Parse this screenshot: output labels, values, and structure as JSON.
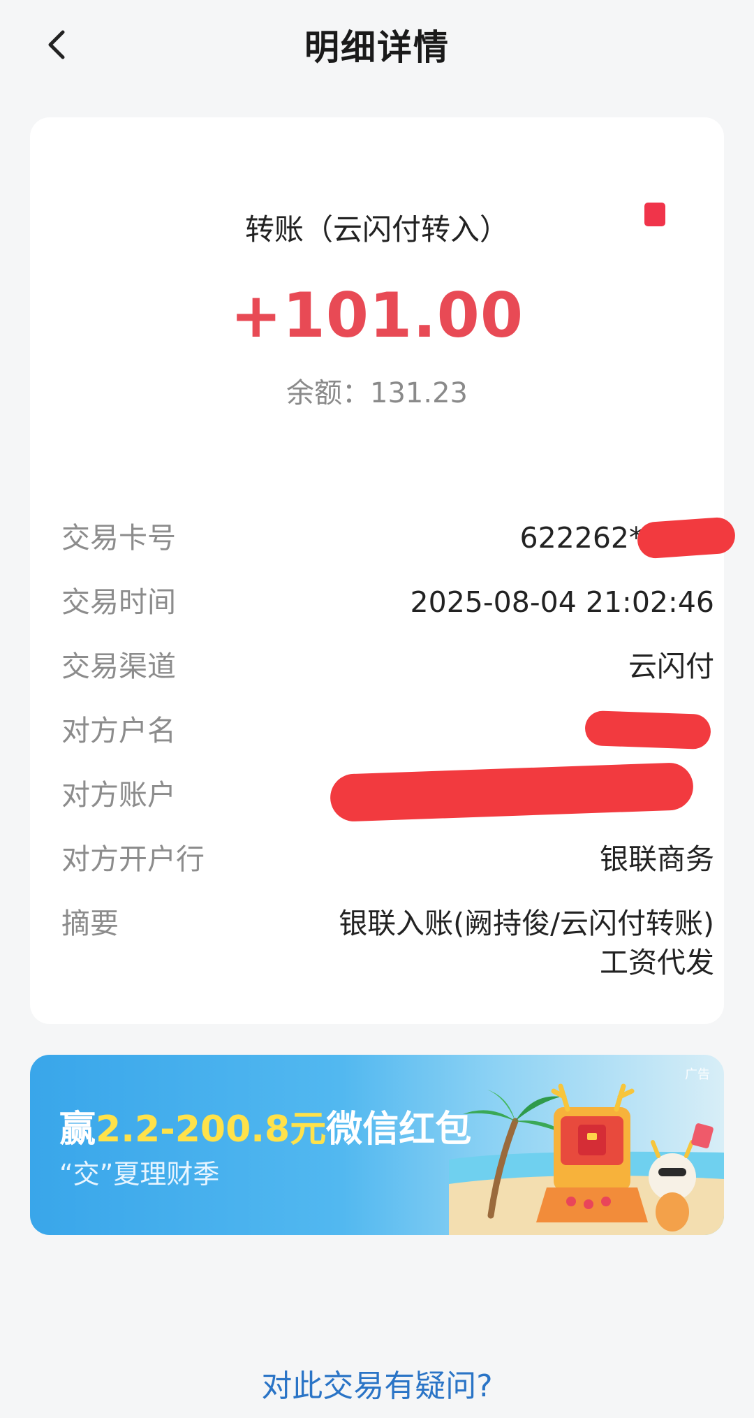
{
  "header": {
    "title": "明细详情"
  },
  "transaction": {
    "type": "转账（云闪付转入）",
    "amount": "+101.00",
    "balance": "余额：131.23",
    "rows": [
      {
        "label": "交易卡号",
        "value": "622262****"
      },
      {
        "label": "交易时间",
        "value": "2025-08-04 21:02:46"
      },
      {
        "label": "交易渠道",
        "value": "云闪付"
      },
      {
        "label": "对方户名",
        "value": ""
      },
      {
        "label": "对方账户",
        "value": ""
      },
      {
        "label": "对方开户行",
        "value": "银联商务"
      },
      {
        "label": "摘要",
        "value": "银联入账(阙持俊/云闪付转账)工资代发"
      }
    ]
  },
  "banner": {
    "prefix": "赢",
    "highlight": "2.2-200.8元",
    "suffix": "微信红包",
    "subtitle": "“交”夏理财季",
    "ad_tag": "广告"
  },
  "footer": {
    "link": "对此交易有疑问?"
  },
  "colors": {
    "amount": "#e84a55",
    "link": "#2a74c6",
    "redaction": "#f23a3f"
  }
}
